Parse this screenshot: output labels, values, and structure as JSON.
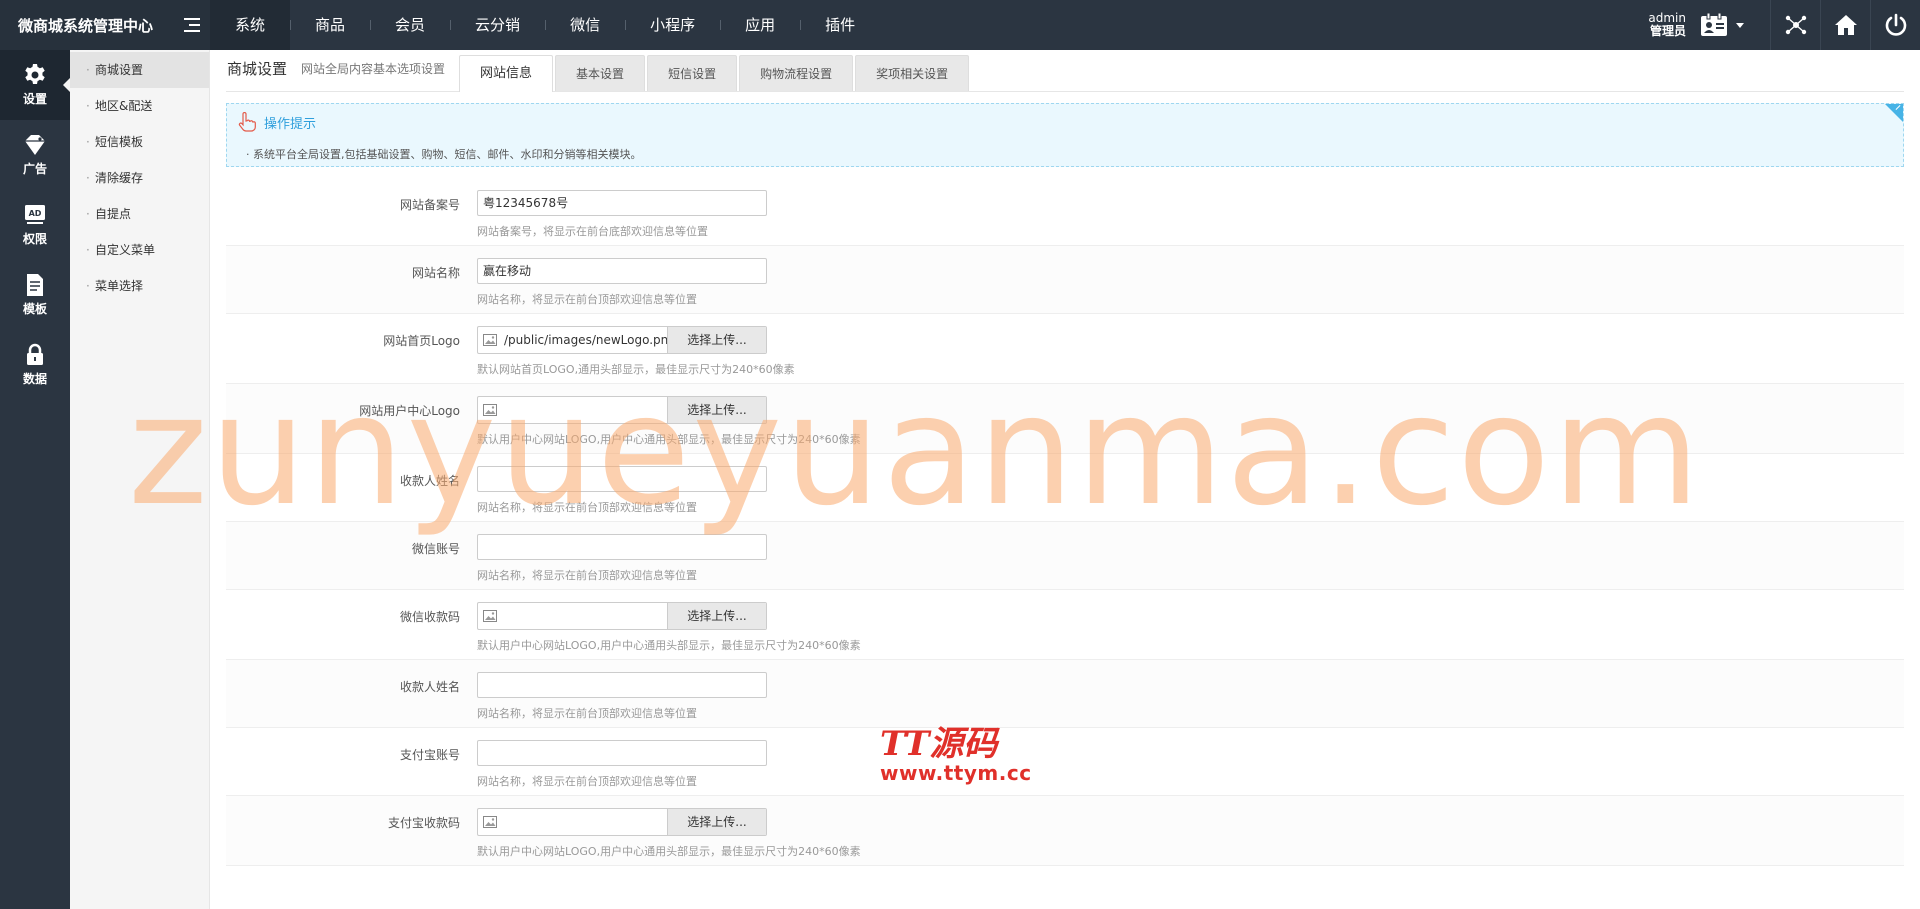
{
  "app": {
    "title": "微商城系统管理中心"
  },
  "topnav": [
    {
      "label": "系统"
    },
    {
      "label": "商品"
    },
    {
      "label": "会员"
    },
    {
      "label": "云分销"
    },
    {
      "label": "微信"
    },
    {
      "label": "小程序"
    },
    {
      "label": "应用"
    },
    {
      "label": "插件"
    }
  ],
  "user": {
    "name": "admin",
    "role": "管理员"
  },
  "iconbar": [
    {
      "label": "设置",
      "icon": "gear-icon"
    },
    {
      "label": "广告",
      "icon": "diamond-tag-icon"
    },
    {
      "label": "权限",
      "icon": "ad-screen-icon"
    },
    {
      "label": "模板",
      "icon": "document-icon"
    },
    {
      "label": "数据",
      "icon": "lock-icon"
    }
  ],
  "submenu": [
    {
      "label": "商城设置"
    },
    {
      "label": "地区&配送"
    },
    {
      "label": "短信模板"
    },
    {
      "label": "清除缓存"
    },
    {
      "label": "自提点"
    },
    {
      "label": "自定义菜单"
    },
    {
      "label": "菜单选择"
    }
  ],
  "page": {
    "title": "商城设置",
    "subtitle": "网站全局内容基本选项设置"
  },
  "tabs": [
    {
      "label": "网站信息"
    },
    {
      "label": "基本设置"
    },
    {
      "label": "短信设置"
    },
    {
      "label": "购物流程设置"
    },
    {
      "label": "奖项相关设置"
    }
  ],
  "tips": {
    "title": "操作提示",
    "text": "·  系统平台全局设置,包括基础设置、购物、短信、邮件、水印和分销等相关模块。"
  },
  "form": {
    "upload_button": "选择上传...",
    "rows": [
      {
        "label": "网站备案号",
        "value": "粤12345678号",
        "hint": "网站备案号，将显示在前台底部欢迎信息等位置"
      },
      {
        "label": "网站名称",
        "value": "赢在移动",
        "hint": "网站名称，将显示在前台顶部欢迎信息等位置"
      },
      {
        "label": "网站首页Logo",
        "value": "/public/images/newLogo.png",
        "hint": "默认网站首页LOGO,通用头部显示，最佳显示尺寸为240*60像素"
      },
      {
        "label": "网站用户中心Logo",
        "value": "",
        "hint": "默认用户中心网站LOGO,用户中心通用头部显示，最佳显示尺寸为240*60像素"
      },
      {
        "label": "收款人姓名",
        "value": "",
        "hint": "网站名称，将显示在前台顶部欢迎信息等位置"
      },
      {
        "label": "微信账号",
        "value": "",
        "hint": "网站名称，将显示在前台顶部欢迎信息等位置"
      },
      {
        "label": "微信收款码",
        "value": "",
        "hint": "默认用户中心网站LOGO,用户中心通用头部显示，最佳显示尺寸为240*60像素"
      },
      {
        "label": "收款人姓名",
        "value": "",
        "hint": "网站名称，将显示在前台顶部欢迎信息等位置"
      },
      {
        "label": "支付宝账号",
        "value": "",
        "hint": "网站名称，将显示在前台顶部欢迎信息等位置"
      },
      {
        "label": "支付宝收款码",
        "value": "",
        "hint": "默认用户中心网站LOGO,用户中心通用头部显示，最佳显示尺寸为240*60像素"
      }
    ]
  },
  "watermarks": {
    "big": "zunyueyuanma.com",
    "logo_line1": "TT源码",
    "logo_line2": "www.ttym.cc"
  },
  "colors": {
    "topbar": "#2b3541",
    "accent": "#2f9fdc",
    "watermark": "#f5a56c",
    "logo_red": "#e0302a"
  }
}
